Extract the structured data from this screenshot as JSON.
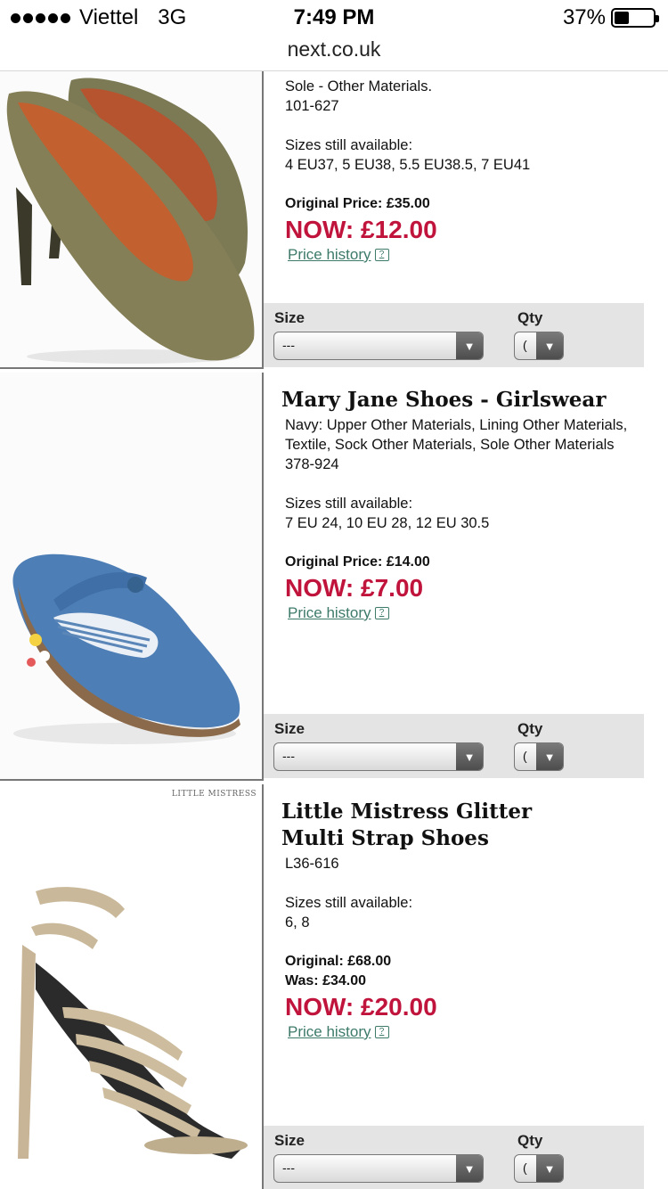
{
  "status": {
    "carrier": "Viettel",
    "network": "3G",
    "time": "7:49 PM",
    "battery": "37%",
    "battery_level": 0.37
  },
  "browser": {
    "url": "next.co.uk"
  },
  "products": [
    {
      "desc_top": "Sole - Other Materials.",
      "code": "101-627",
      "sizes_heading": "Sizes still available:",
      "sizes": "4 EU37, 5 EU38, 5.5 EU38.5, 7 EU41",
      "original_price": "Original Price: £35.00",
      "now_price": "NOW: £12.00",
      "price_history": "Price history",
      "size_label": "Size",
      "size_value": "---",
      "qty_label": "Qty",
      "qty_value": "("
    },
    {
      "title": "Mary Jane Shoes - Girlswear",
      "description": "Navy: Upper Other Materials, Lining Other Materials, Textile, Sock Other Materials, Sole Other Materials",
      "code": "378-924",
      "sizes_heading": "Sizes still available:",
      "sizes": "7 EU 24, 10 EU 28, 12 EU 30.5",
      "original_price": "Original Price: £14.00",
      "now_price": "NOW: £7.00",
      "price_history": "Price history",
      "size_label": "Size",
      "size_value": "---",
      "qty_label": "Qty",
      "qty_value": "("
    },
    {
      "brand_logo": "LITTLE MISTRESS",
      "title": "Little Mistress Glitter Multi Strap Shoes",
      "code": "L36-616",
      "sizes_heading": "Sizes still available:",
      "sizes": "6, 8",
      "original_price": "Original: £68.00",
      "was_price": "Was: £34.00",
      "now_price": "NOW: £20.00",
      "price_history": "Price history",
      "size_label": "Size",
      "size_value": "---",
      "qty_label": "Qty",
      "qty_value": "("
    }
  ],
  "icons": {
    "help": "help-icon",
    "dropdown": "chevron-down-icon"
  }
}
